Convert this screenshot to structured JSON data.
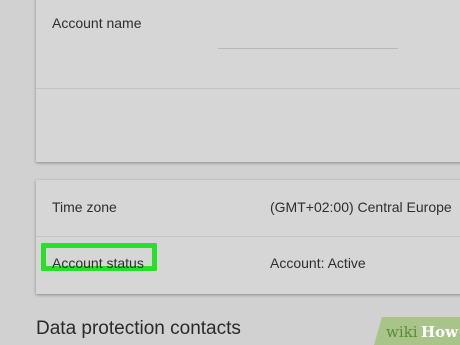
{
  "account_settings": {
    "account_name_label": "Account name"
  },
  "details_table": {
    "rows": [
      {
        "label": "Time zone",
        "value": "(GMT+02:00) Central Europe"
      },
      {
        "label": "Account status",
        "value": "Account: Active"
      }
    ],
    "highlight_color": "#28e028"
  },
  "section": {
    "heading": "Data protection contacts"
  },
  "watermark": {
    "part1": "wiki",
    "part2": "How"
  }
}
